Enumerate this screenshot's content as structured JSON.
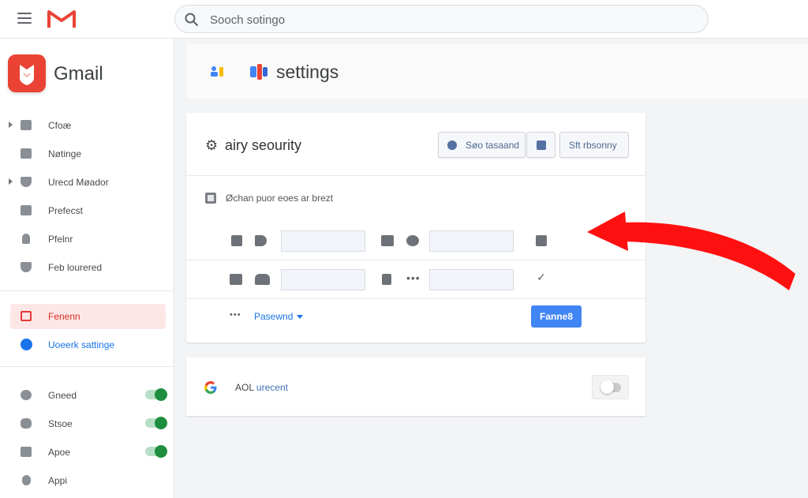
{
  "topbar": {
    "search_placeholder": "Sooch sotingo"
  },
  "sidebar": {
    "brand": "Gmail",
    "items": [
      {
        "label": "Cfoæ",
        "icon": "inbox-icon"
      },
      {
        "label": "Nøtinge",
        "icon": "mail-icon"
      },
      {
        "label": "Urecd Møador",
        "icon": "shield-icon"
      },
      {
        "label": "Prefecst",
        "icon": "card-icon"
      },
      {
        "label": "Pfelnr",
        "icon": "person-icon"
      },
      {
        "label": "Feb lourered",
        "icon": "shield-icon"
      }
    ],
    "active_item": {
      "label": "Fenenn",
      "icon": "security-icon"
    },
    "link_item": {
      "label": "Uoeerk sattinge",
      "icon": "google-icon"
    },
    "toggles": [
      {
        "label": "Gneed",
        "icon": "settings-icon",
        "on": true
      },
      {
        "label": "Stsoe",
        "icon": "storage-icon",
        "on": true
      },
      {
        "label": "Apoe",
        "icon": "apps-icon",
        "on": true
      }
    ],
    "last_item": {
      "label": "Appi",
      "icon": "device-icon"
    }
  },
  "header": {
    "title": "settings"
  },
  "security_card": {
    "title": "airy seourity",
    "buttons": [
      "Søo tasaand",
      "Sft rbsonny"
    ],
    "option_label": "Øchan puor eoes ar brezt",
    "password_link": "Pasewnd",
    "action_button": "Fanne8"
  },
  "account_card": {
    "label_prefix": "AOL",
    "label_rest": "urecent",
    "toggle_on": false
  },
  "colors": {
    "brand_red": "#ea4335",
    "accent_blue": "#4285f4",
    "toggle_green": "#1e8e3e",
    "arrow_red": "#ff1010"
  }
}
